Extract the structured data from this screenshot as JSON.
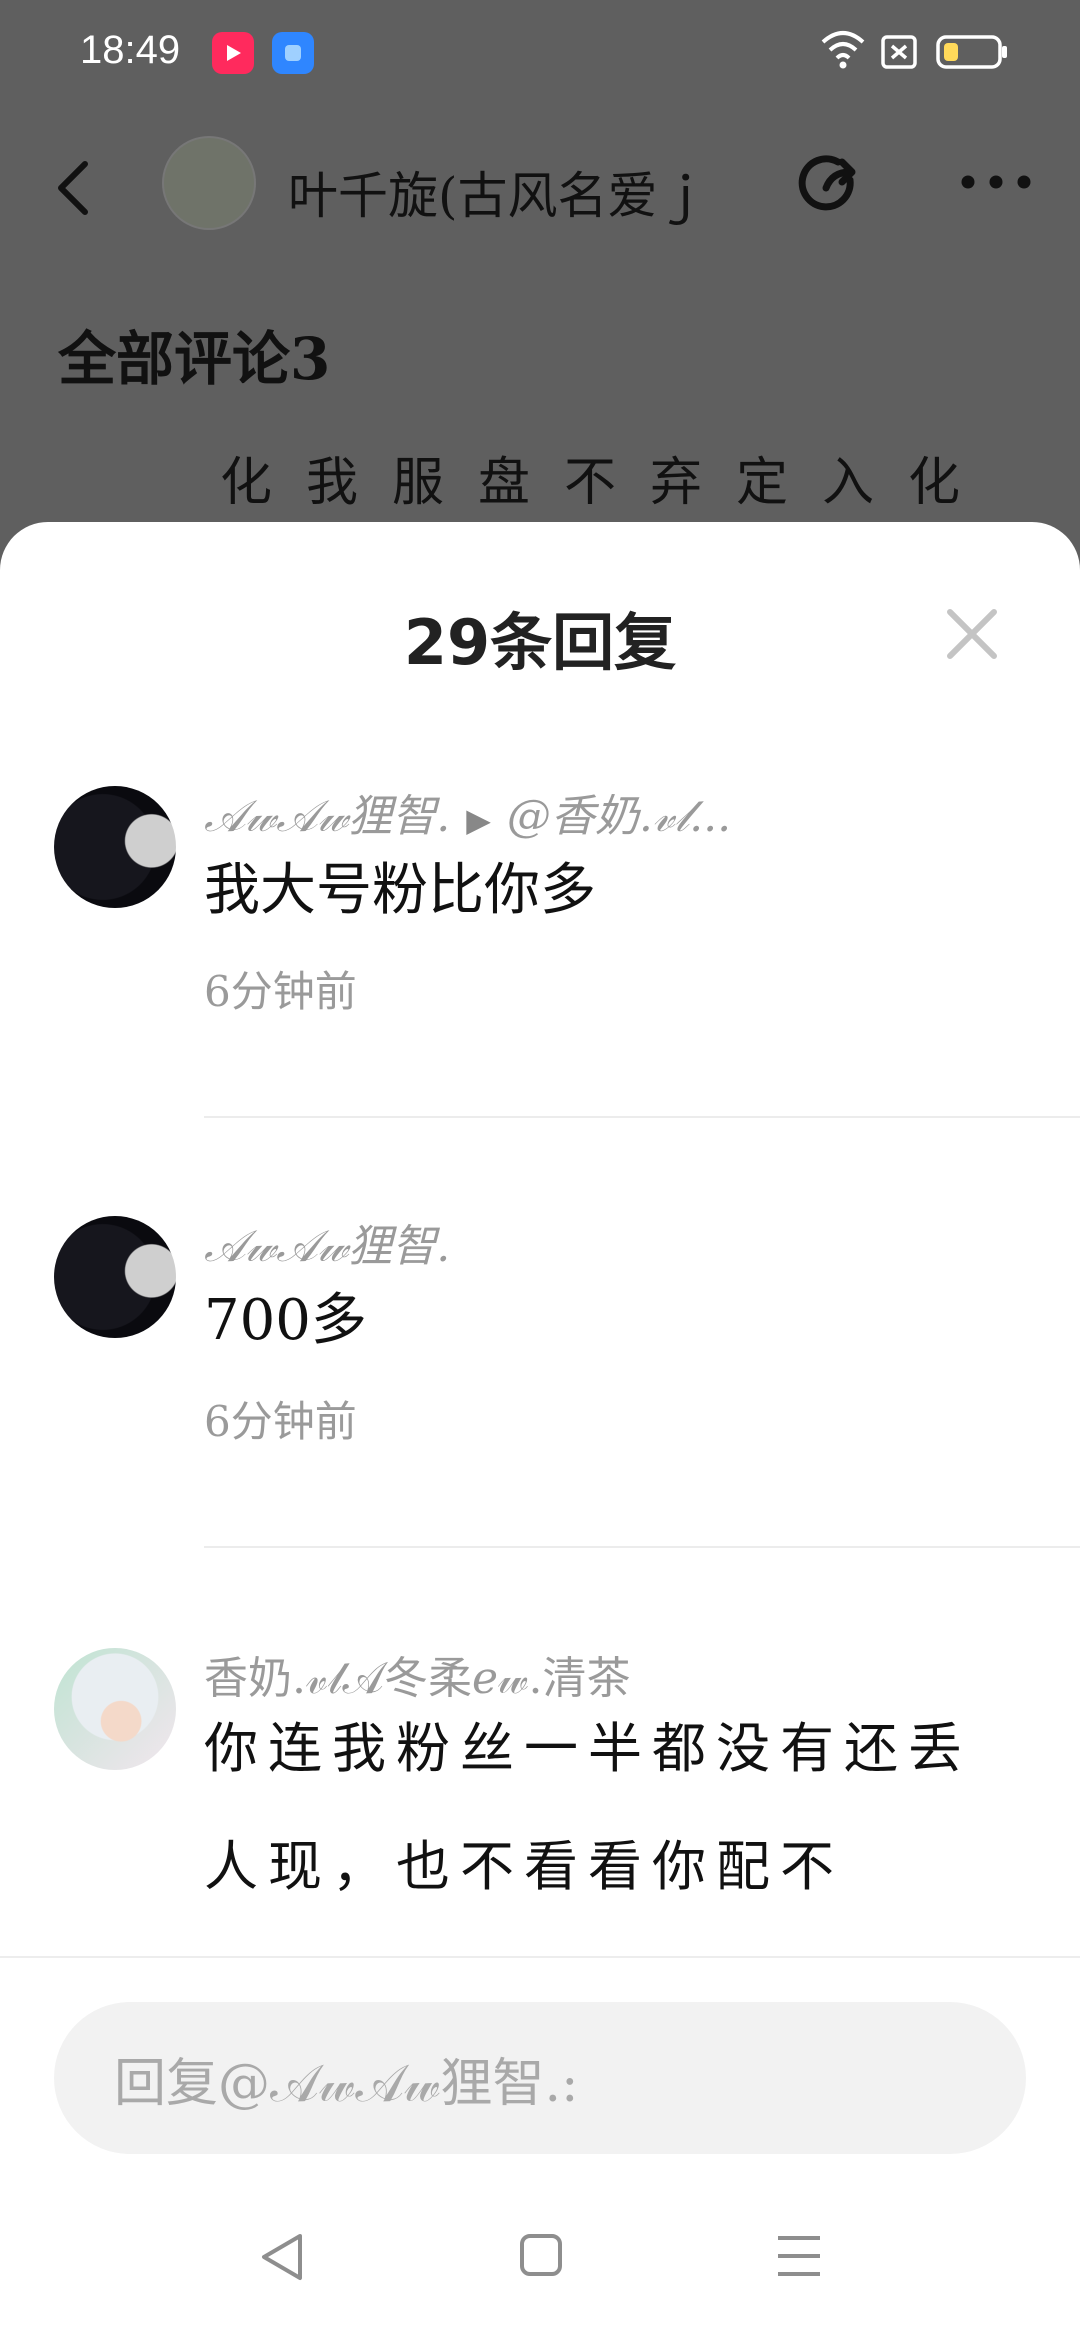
{
  "status_bar": {
    "time": "18:49"
  },
  "top_bar": {
    "title": "叶千旋(古风名爱ｊ"
  },
  "background": {
    "comments_heading": "全部评论3",
    "partial_line": "化我服盘不弃定入化"
  },
  "sheet": {
    "title": "29条回复",
    "replies": [
      {
        "user": "𝒜𝓌𝒜𝓌狸智.",
        "reply_to": "@香奶.𝓋𝓁...",
        "text": "我大号粉比你多",
        "time": "6分钟前"
      },
      {
        "user": "𝒜𝓌𝒜𝓌狸智.",
        "text": "700多",
        "time": "6分钟前"
      },
      {
        "user": "香奶.𝓋𝓁𝒜冬柔𝑒𝓌.清茶",
        "text": "你连我粉丝一半都没有还丢人现，也不看看你配不"
      }
    ]
  },
  "input": {
    "placeholder": "回复@𝒜𝓌𝒜𝓌狸智.:"
  },
  "icons": {
    "back": "chevron-left-icon",
    "share": "share-icon",
    "more": "more-icon",
    "close": "close-icon"
  },
  "colors": {
    "overlay": "#5f5f5f",
    "sheet": "#ffffff",
    "muted_text": "#9a9a9a",
    "input_bg": "#f2f2f2"
  }
}
